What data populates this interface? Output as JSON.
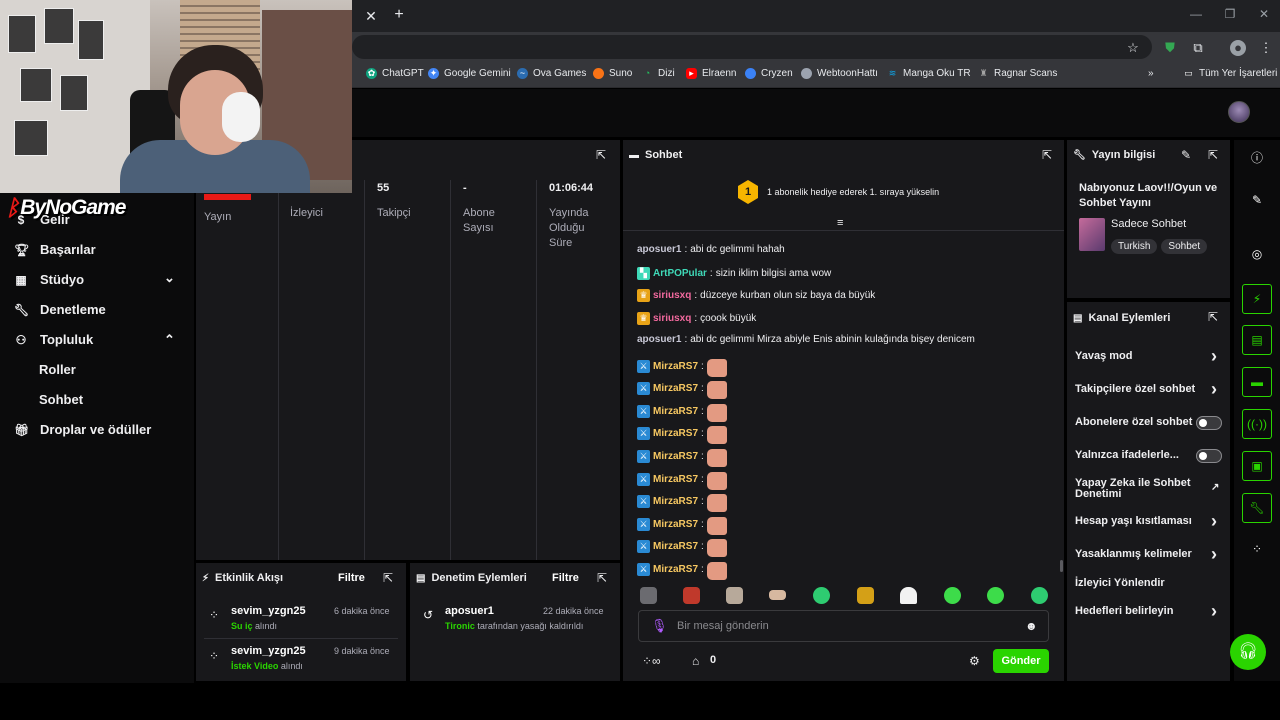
{
  "browser": {
    "bookmarks": [
      {
        "label": "ChatGPT",
        "color": "#10a37f"
      },
      {
        "label": "Google Gemini",
        "color": "#4285f4"
      },
      {
        "label": "Ova Games",
        "color": "#2b6cb0"
      },
      {
        "label": "Suno",
        "color": "#f97316"
      },
      {
        "label": "Dizi",
        "color": "#22c55e"
      },
      {
        "label": "Elraenn",
        "color": "#ff0000"
      },
      {
        "label": "Cryzen",
        "color": "#3b82f6"
      },
      {
        "label": "WebtoonHattı",
        "color": "#9ca3af"
      },
      {
        "label": "Manga Oku TR",
        "color": "#0ea5e9"
      },
      {
        "label": "Ragnar Scans",
        "color": "#a3a3a3"
      }
    ],
    "all_bookmarks_label": "Tüm Yer İşaretleri"
  },
  "logo": {
    "text": "ByNoGame"
  },
  "nav": {
    "items": [
      {
        "label": "Gelir"
      },
      {
        "label": "Başarılar"
      },
      {
        "label": "Stüdyo"
      },
      {
        "label": "Denetleme"
      },
      {
        "label": "Topluluk"
      },
      {
        "label": "Roller"
      },
      {
        "label": "Sohbet"
      },
      {
        "label": "Droplar ve ödüller"
      }
    ]
  },
  "stats": {
    "columns": [
      {
        "value": "",
        "label": "Yayın"
      },
      {
        "value": "",
        "label": "İzleyici"
      },
      {
        "value": "55",
        "label": "Takipçi"
      },
      {
        "value": "-",
        "label": "Abone Sayısı"
      },
      {
        "value": "01:06:44",
        "label": "Yayında Olduğu Süre"
      }
    ]
  },
  "activity": {
    "title": "Etkinlik Akışı",
    "filter": "Filtre",
    "items": [
      {
        "user": "sevim_yzgn25",
        "time": "6 dakika önce",
        "reward": "Su iç",
        "suffix": " alındı"
      },
      {
        "user": "sevim_yzgn25",
        "time": "9 dakika önce",
        "reward": "İstek Video",
        "suffix": " alındı"
      }
    ]
  },
  "moderation": {
    "title": "Denetim Eylemleri",
    "filter": "Filtre",
    "items": [
      {
        "user": "aposuer1",
        "time": "22 dakika önce",
        "actor": "Tironic",
        "suffix": " tarafından yasağı kaldırıldı"
      }
    ]
  },
  "chat": {
    "title": "Sohbet",
    "hype": {
      "rank": "1",
      "text": "1 abonelik hediye ederek 1. sıraya yükselin"
    },
    "messages": [
      {
        "user": "aposuer1",
        "color": "#c8c8d6",
        "badge": "",
        "text": "abi dc gelimmi hahah",
        "hand": false
      },
      {
        "user": "ArtPOPular",
        "color": "#3fd9b8",
        "badge": "tile",
        "text": "sizin iklim bilgisi ama wow",
        "hand": false
      },
      {
        "user": "siriusxq",
        "color": "#f2699e",
        "badge": "crown",
        "text": "düzceye kurban olun siz baya da büyük",
        "hand": false
      },
      {
        "user": "siriusxq",
        "color": "#f2699e",
        "badge": "crown",
        "text": "çoook büyük",
        "hand": false
      },
      {
        "user": "aposuer1",
        "color": "#c8c8d6",
        "badge": "",
        "text": "abi dc gelimmi Mirza abiyle Enis abinin kulağında bişey denicem",
        "hand": false
      },
      {
        "user": "MirzaRS7",
        "color": "#f7c862",
        "badge": "sword",
        "text": "",
        "hand": true
      },
      {
        "user": "MirzaRS7",
        "color": "#f7c862",
        "badge": "sword",
        "text": "",
        "hand": true
      },
      {
        "user": "MirzaRS7",
        "color": "#f7c862",
        "badge": "sword",
        "text": "",
        "hand": true
      },
      {
        "user": "MirzaRS7",
        "color": "#f7c862",
        "badge": "sword",
        "text": "",
        "hand": true
      },
      {
        "user": "MirzaRS7",
        "color": "#f7c862",
        "badge": "sword",
        "text": "",
        "hand": true
      },
      {
        "user": "MirzaRS7",
        "color": "#f7c862",
        "badge": "sword",
        "text": "",
        "hand": true
      },
      {
        "user": "MirzaRS7",
        "color": "#f7c862",
        "badge": "sword",
        "text": "",
        "hand": true
      },
      {
        "user": "MirzaRS7",
        "color": "#f7c862",
        "badge": "sword",
        "text": "",
        "hand": true
      },
      {
        "user": "MirzaRS7",
        "color": "#f7c862",
        "badge": "sword",
        "text": "",
        "hand": true
      },
      {
        "user": "MirzaRS7",
        "color": "#f7c862",
        "badge": "sword",
        "text": "",
        "hand": true
      }
    ],
    "input_placeholder": "Bir mesaj gönderin",
    "points": "0",
    "send_label": "Gönder"
  },
  "stream_info": {
    "title": "Yayın bilgisi",
    "stream_title": "Nabıyonuz Laov!!/Oyun ve Sohbet Yayını",
    "category": "Sadece Sohbet",
    "tags": [
      "Turkish",
      "Sohbet"
    ]
  },
  "channel_actions": {
    "title": "Kanal Eylemleri",
    "rows": [
      {
        "label": "Yavaş mod",
        "kind": "chevron"
      },
      {
        "label": "Takipçilere özel sohbet",
        "kind": "chevron"
      },
      {
        "label": "Abonelere özel sohbet",
        "kind": "toggle"
      },
      {
        "label": "Yalnızca ifadelerle...",
        "kind": "toggle"
      },
      {
        "label": "Yapay Zeka ile Sohbet Denetimi",
        "kind": "external"
      },
      {
        "label": "Hesap yaşı kısıtlaması",
        "kind": "chevron"
      },
      {
        "label": "Yasaklanmış kelimeler",
        "kind": "chevron"
      },
      {
        "label": "İzleyici Yönlendir",
        "kind": "none"
      },
      {
        "label": "Hedefleri belirleyin",
        "kind": "chevron"
      }
    ]
  },
  "colors": {
    "accent_green": "#2ad400",
    "danger_red": "#e91916"
  }
}
